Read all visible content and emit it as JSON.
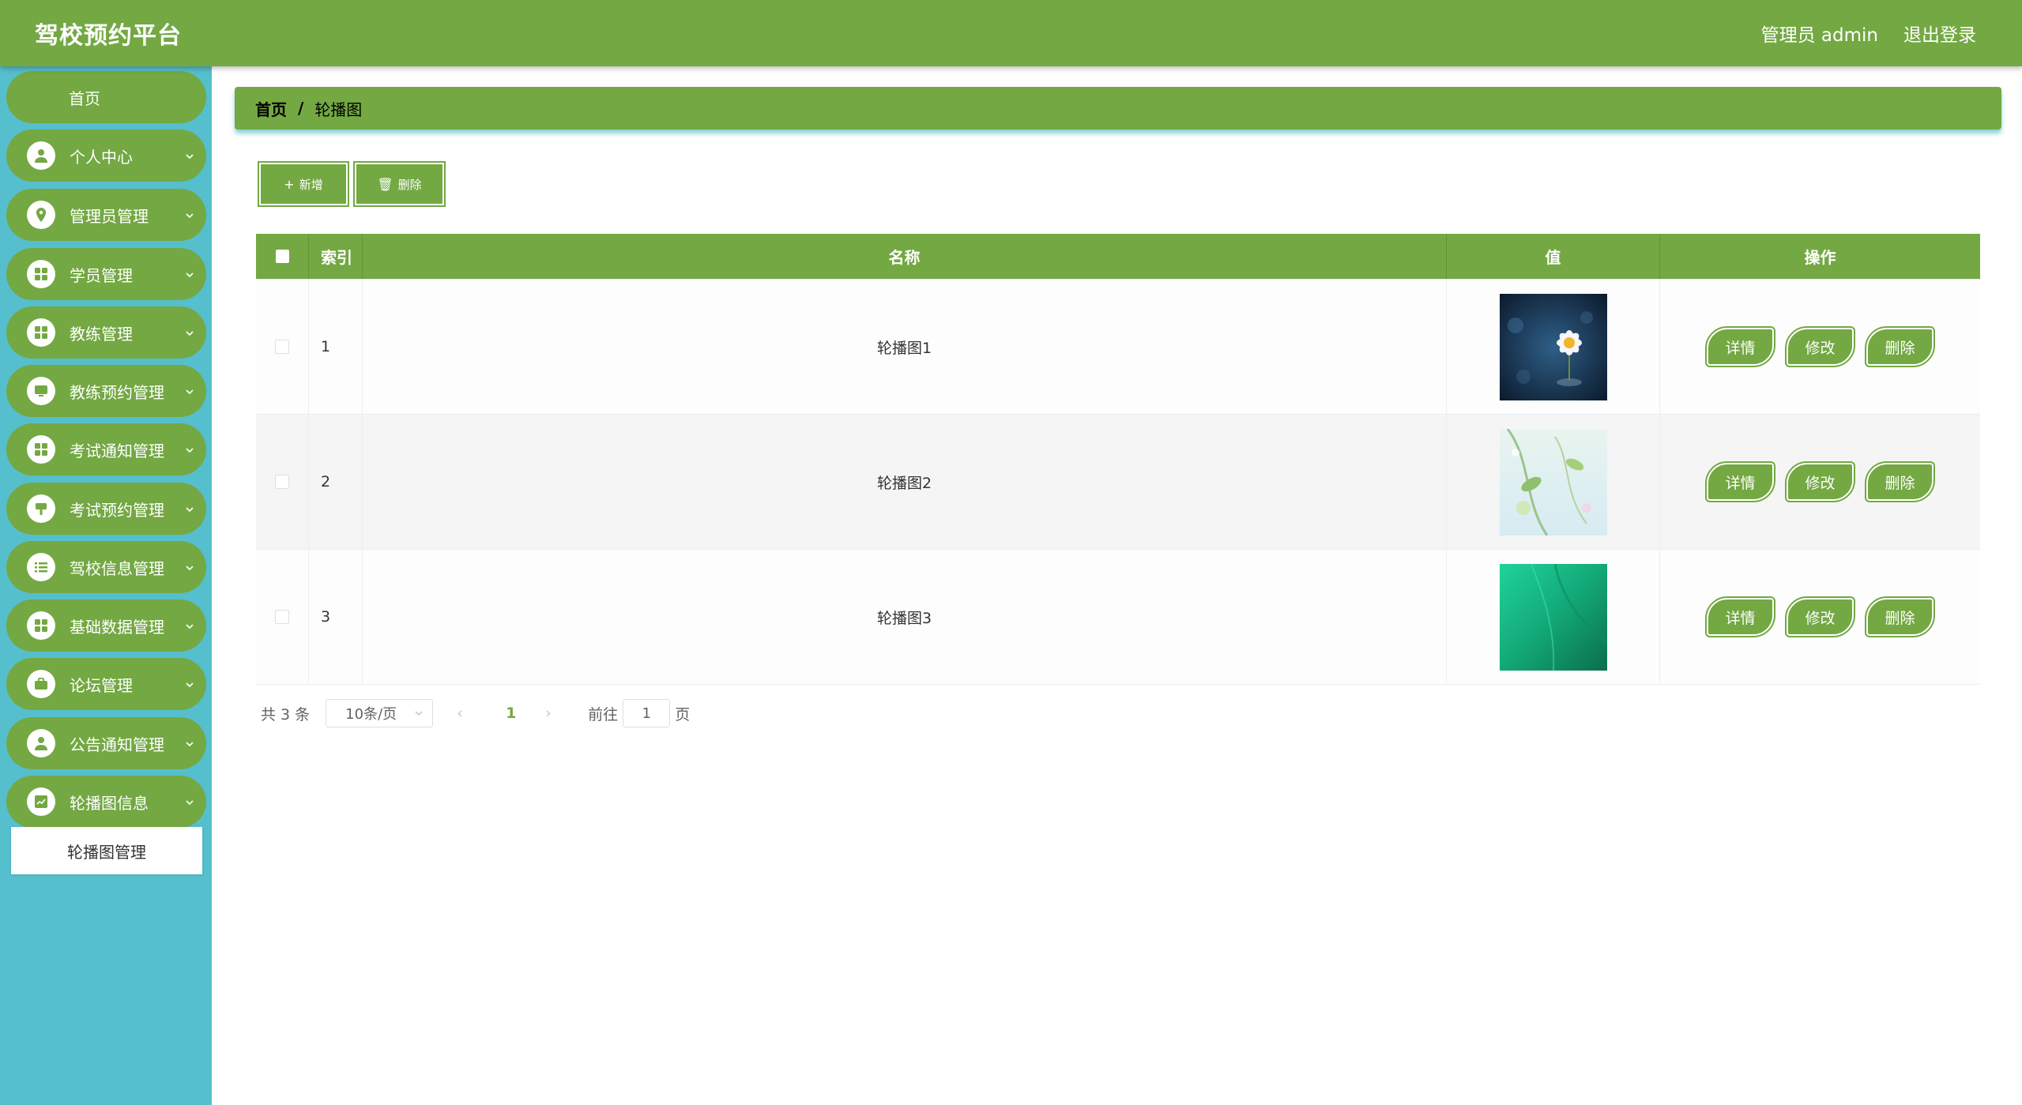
{
  "app": {
    "title": "驾校预约平台"
  },
  "header": {
    "user_label": "管理员 admin",
    "logout_label": "退出登录"
  },
  "sidebar": {
    "home": "首页",
    "items": [
      {
        "label": "个人中心",
        "icon": "user-icon"
      },
      {
        "label": "管理员管理",
        "icon": "pin-icon"
      },
      {
        "label": "学员管理",
        "icon": "grid-icon"
      },
      {
        "label": "教练管理",
        "icon": "grid-icon"
      },
      {
        "label": "教练预约管理",
        "icon": "monitor-icon"
      },
      {
        "label": "考试通知管理",
        "icon": "grid-icon"
      },
      {
        "label": "考试预约管理",
        "icon": "sign-icon"
      },
      {
        "label": "驾校信息管理",
        "icon": "list-icon"
      },
      {
        "label": "基础数据管理",
        "icon": "grid-icon"
      },
      {
        "label": "论坛管理",
        "icon": "briefcase-icon"
      },
      {
        "label": "公告通知管理",
        "icon": "user-icon"
      },
      {
        "label": "轮播图信息",
        "icon": "chart-icon"
      }
    ],
    "submenu": {
      "label": "轮播图管理"
    }
  },
  "breadcrumb": {
    "home": "首页",
    "separator": "/",
    "current": "轮播图"
  },
  "toolbar": {
    "add_label": "新增",
    "delete_label": "删除"
  },
  "table": {
    "headers": {
      "index": "索引",
      "name": "名称",
      "value": "值",
      "ops": "操作"
    },
    "rows": [
      {
        "index": "1",
        "name": "轮播图1",
        "image": "flower-image"
      },
      {
        "index": "2",
        "name": "轮播图2",
        "image": "plant-image"
      },
      {
        "index": "3",
        "name": "轮播图3",
        "image": "green-image"
      }
    ],
    "row_actions": {
      "detail": "详情",
      "edit": "修改",
      "delete": "删除"
    }
  },
  "pagination": {
    "total": "共 3 条",
    "page_size": "10条/页",
    "current_page": "1",
    "goto_label": "前往",
    "goto_value": "1",
    "page_suffix": "页"
  },
  "colors": {
    "primary": "#73a843",
    "sidebar": "#56bfcd"
  }
}
